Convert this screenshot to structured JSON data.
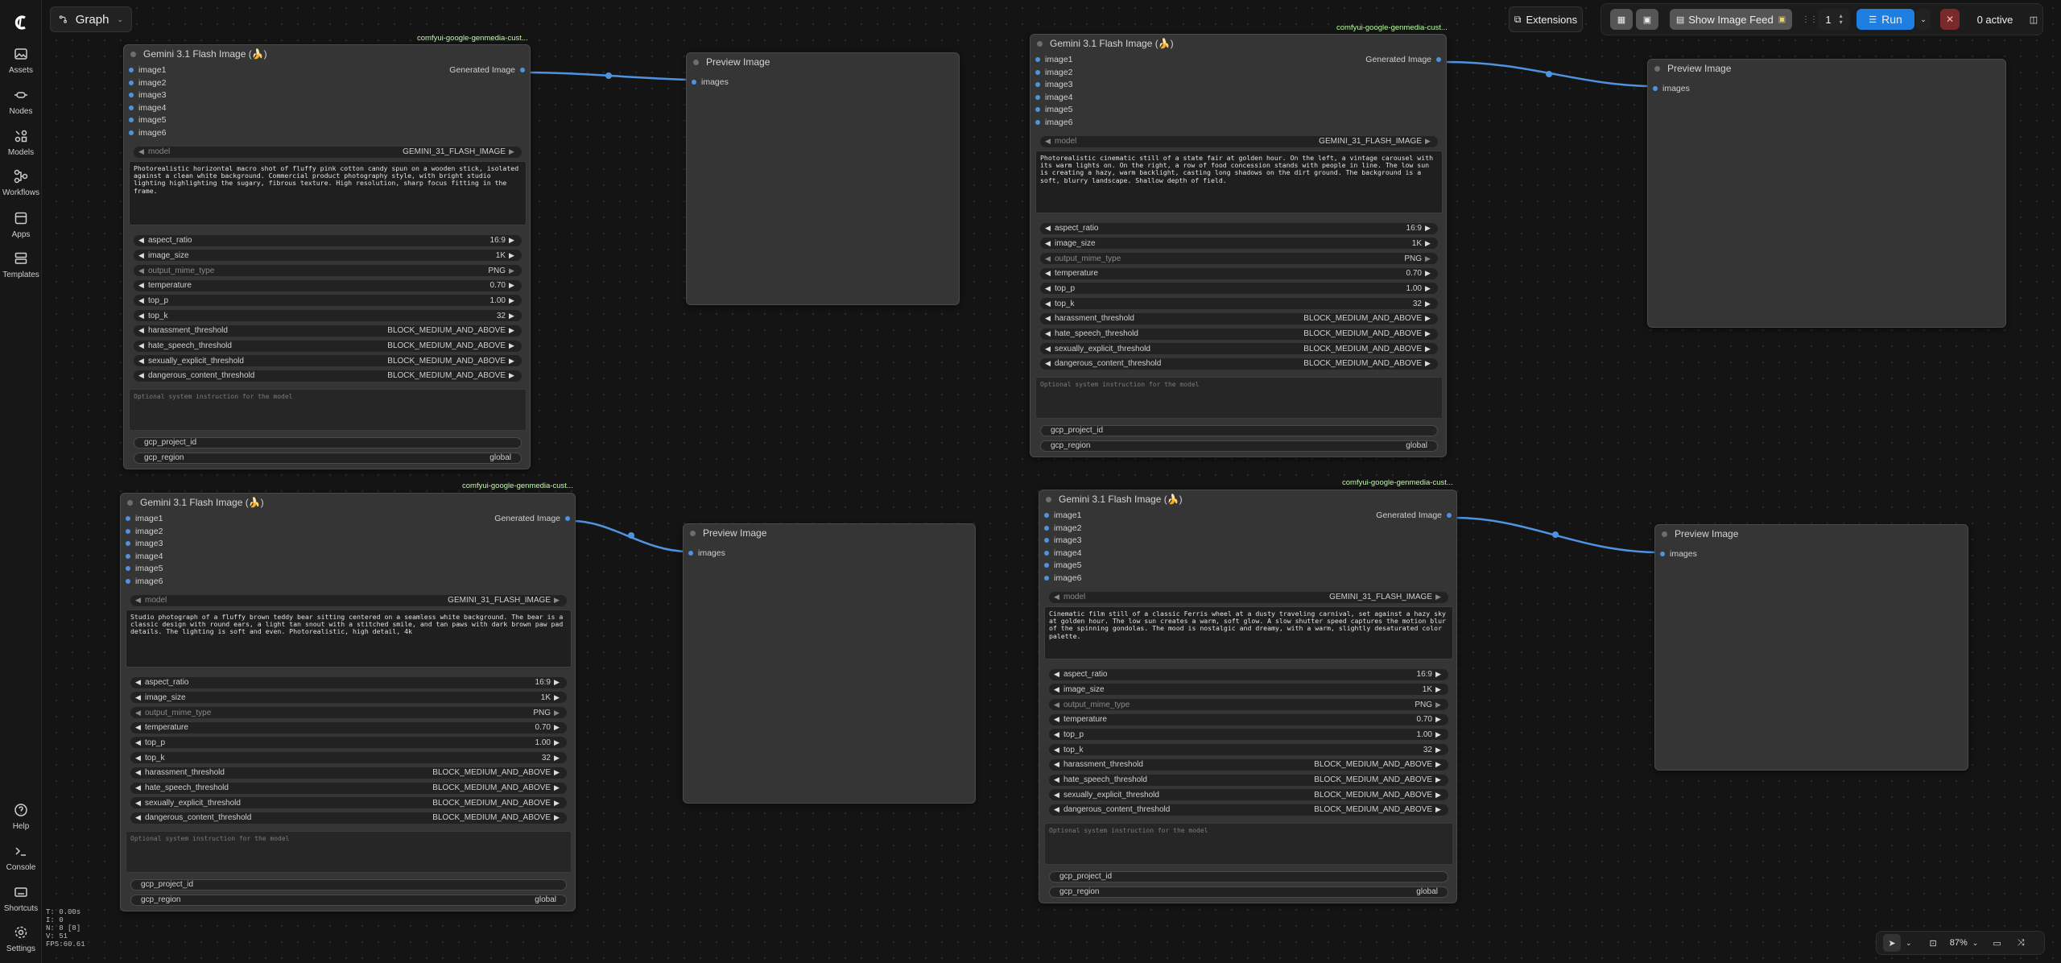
{
  "sidebar": {
    "items": [
      {
        "label": "Assets",
        "icon": "image-icon"
      },
      {
        "label": "Nodes",
        "icon": "nodes-icon"
      },
      {
        "label": "Models",
        "icon": "models-icon"
      },
      {
        "label": "Workflows",
        "icon": "workflow-icon"
      },
      {
        "label": "Apps",
        "icon": "apps-icon"
      },
      {
        "label": "Templates",
        "icon": "templates-icon"
      }
    ],
    "bottom": [
      {
        "label": "Help",
        "icon": "help-icon"
      },
      {
        "label": "Console",
        "icon": "console-icon"
      },
      {
        "label": "Shortcuts",
        "icon": "keyboard-icon"
      },
      {
        "label": "Settings",
        "icon": "gear-icon"
      }
    ],
    "stats": [
      "T: 0.00s",
      "I: 0",
      "N: 8 [8]",
      "V: 51",
      "FPS:60.61"
    ]
  },
  "topbar": {
    "graph_label": "Graph",
    "extensions_label": "Extensions",
    "show_feed_label": "Show Image Feed",
    "queue_count": "1",
    "run_label": "Run",
    "active_label": "0 active"
  },
  "gemini_node": {
    "title": "Gemini 3.1 Flash Image (🍌)",
    "badge": "comfyui-google-genmedia-cust...",
    "output_label": "Generated Image",
    "inputs": [
      "image1",
      "image2",
      "image3",
      "image4",
      "image5",
      "image6"
    ],
    "model_label": "model",
    "model_value": "GEMINI_31_FLASH_IMAGE",
    "widgets": [
      {
        "label": "aspect_ratio",
        "value": "16:9"
      },
      {
        "label": "image_size",
        "value": "1K"
      },
      {
        "label": "output_mime_type",
        "value": "PNG"
      },
      {
        "label": "temperature",
        "value": "0.70"
      },
      {
        "label": "top_p",
        "value": "1.00"
      },
      {
        "label": "top_k",
        "value": "32"
      },
      {
        "label": "harassment_threshold",
        "value": "BLOCK_MEDIUM_AND_ABOVE"
      },
      {
        "label": "hate_speech_threshold",
        "value": "BLOCK_MEDIUM_AND_ABOVE"
      },
      {
        "label": "sexually_explicit_threshold",
        "value": "BLOCK_MEDIUM_AND_ABOVE"
      },
      {
        "label": "dangerous_content_threshold",
        "value": "BLOCK_MEDIUM_AND_ABOVE"
      }
    ],
    "system_placeholder": "Optional system instruction for the model",
    "project_label": "gcp_project_id",
    "region_label": "gcp_region",
    "region_value": "global"
  },
  "prompts": [
    "Photorealistic horizontal macro shot of fluffy pink cotton candy spun on a wooden stick, isolated against a clean white background. Commercial product photography style, with bright studio lighting highlighting the sugary, fibrous texture. High resolution, sharp focus fitting in the frame.",
    "Photorealistic cinematic still of a state fair at golden hour. On the left, a vintage carousel with its warm lights on. On the right, a row of food concession stands with people in line. The low sun is creating a hazy, warm backlight, casting long shadows on the dirt ground. The background is a soft, blurry landscape. Shallow depth of field.",
    "Studio photograph of a fluffy brown teddy bear sitting centered on a seamless white background. The bear is a classic design with round ears, a light tan snout with a stitched smile, and tan paws with dark brown paw pad details. The lighting is soft and even. Photorealistic, high detail, 4k",
    "Cinematic film still of a classic Ferris wheel at a dusty traveling carnival, set against a hazy sky at golden hour. The low sun creates a warm, soft glow. A slow shutter speed captures the motion blur of the spinning gondolas. The mood is nostalgic and dreamy, with a warm, slightly desaturated color palette."
  ],
  "preview_node": {
    "title": "Preview Image",
    "input_label": "images"
  },
  "bottom_bar": {
    "zoom": "87%"
  },
  "colors": {
    "link": "#4f93e0",
    "run_button": "#1f7fe0",
    "badge_text": "#b9ffa0"
  }
}
